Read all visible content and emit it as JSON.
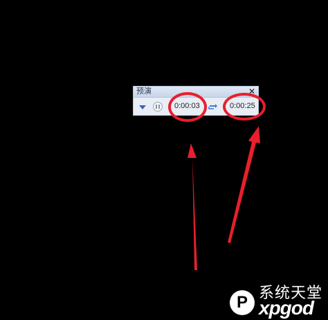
{
  "preview_window": {
    "title": "预演",
    "close_symbol": "✕",
    "current_time": "0:00:03",
    "total_time": "0:00:25",
    "icons": [
      "dropdown-arrow-icon",
      "pause-icon",
      "loop-icon",
      "close-icon"
    ]
  },
  "annotations": {
    "marker_color": "#e81f2d",
    "arrow_color": "#e81f2d"
  },
  "watermark": {
    "chinese": "系统天堂",
    "english": "xpgod"
  }
}
